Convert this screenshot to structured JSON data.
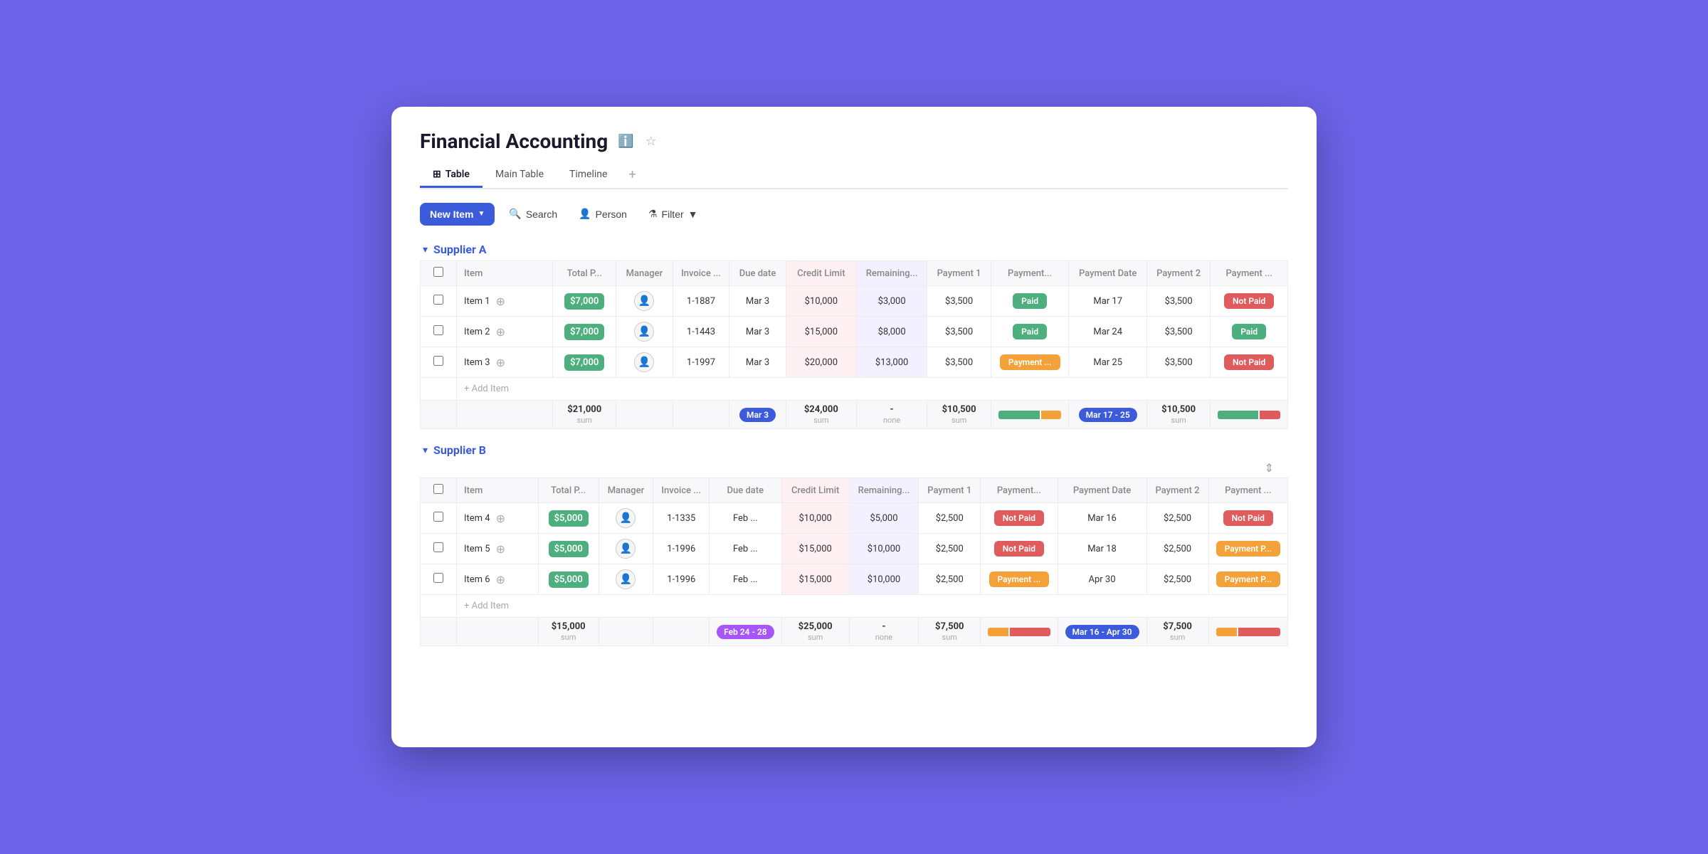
{
  "app": {
    "title": "Financial Accounting",
    "info_icon": "ℹ",
    "star_icon": "☆"
  },
  "tabs": [
    {
      "label": "Table",
      "icon": "⊞",
      "active": true
    },
    {
      "label": "Main Table",
      "active": false
    },
    {
      "label": "Timeline",
      "active": false
    }
  ],
  "toolbar": {
    "new_item_label": "New Item",
    "search_label": "Search",
    "person_label": "Person",
    "filter_label": "Filter"
  },
  "supplier_a": {
    "title": "Supplier A",
    "columns": [
      "Item",
      "Total P...",
      "Manager",
      "Invoice ...",
      "Due date",
      "Credit Limit",
      "Remaining...",
      "Payment 1",
      "Payment...",
      "Payment Date",
      "Payment 2",
      "Payment ..."
    ],
    "rows": [
      {
        "item": "Item 1",
        "total": "$7,000",
        "invoice": "1-1887",
        "due_date": "Mar 3",
        "credit_limit": "$10,000",
        "remaining": "$3,000",
        "payment1": "$3,500",
        "status1": "Paid",
        "status1_type": "paid",
        "payment_date": "Mar 17",
        "payment2": "$3,500",
        "status2": "Not Paid",
        "status2_type": "not-paid"
      },
      {
        "item": "Item 2",
        "total": "$7,000",
        "invoice": "1-1443",
        "due_date": "Mar 3",
        "credit_limit": "$15,000",
        "remaining": "$8,000",
        "payment1": "$3,500",
        "status1": "Paid",
        "status1_type": "paid",
        "payment_date": "Mar 24",
        "payment2": "$3,500",
        "status2": "Paid",
        "status2_type": "paid"
      },
      {
        "item": "Item 3",
        "total": "$7,000",
        "invoice": "1-1997",
        "due_date": "Mar 3",
        "credit_limit": "$20,000",
        "remaining": "$13,000",
        "payment1": "$3,500",
        "status1": "Payment ...",
        "status1_type": "payment-p",
        "payment_date": "Mar 25",
        "payment2": "$3,500",
        "status2": "Not Paid",
        "status2_type": "not-paid"
      }
    ],
    "add_item": "+ Add Item",
    "summary": {
      "total": "$21,000",
      "due_date": "Mar 3",
      "credit_limit": "$24,000",
      "remaining": "-",
      "remaining_sub": "none",
      "payment1": "$10,500",
      "payment2": "$10,500",
      "date_range": "Mar 17 - 25"
    }
  },
  "supplier_b": {
    "title": "Supplier B",
    "columns": [
      "Item",
      "Total P...",
      "Manager",
      "Invoice ...",
      "Due date",
      "Credit Limit",
      "Remaining...",
      "Payment 1",
      "Payment...",
      "Payment Date",
      "Payment 2",
      "Payment ..."
    ],
    "rows": [
      {
        "item": "Item 4",
        "total": "$5,000",
        "invoice": "1-1335",
        "due_date": "Feb ...",
        "credit_limit": "$10,000",
        "remaining": "$5,000",
        "payment1": "$2,500",
        "status1": "Not Paid",
        "status1_type": "not-paid",
        "payment_date": "Mar 16",
        "payment2": "$2,500",
        "status2": "Not Paid",
        "status2_type": "not-paid"
      },
      {
        "item": "Item 5",
        "total": "$5,000",
        "invoice": "1-1996",
        "due_date": "Feb ...",
        "credit_limit": "$15,000",
        "remaining": "$10,000",
        "payment1": "$2,500",
        "status1": "Not Paid",
        "status1_type": "not-paid",
        "payment_date": "Mar 18",
        "payment2": "$2,500",
        "status2": "Payment P...",
        "status2_type": "payment-p"
      },
      {
        "item": "Item 6",
        "total": "$5,000",
        "invoice": "1-1996",
        "due_date": "Feb ...",
        "credit_limit": "$15,000",
        "remaining": "$10,000",
        "payment1": "$2,500",
        "status1": "Payment ...",
        "status1_type": "payment-p",
        "payment_date": "Apr 30",
        "payment2": "$2,500",
        "status2": "Payment P...",
        "status2_type": "payment-p"
      }
    ],
    "add_item": "+ Add Item",
    "summary": {
      "total": "$15,000",
      "due_date": "Feb 24 - 28",
      "credit_limit": "$25,000",
      "remaining": "-",
      "remaining_sub": "none",
      "payment1": "$7,500",
      "payment2": "$7,500",
      "date_range": "Mar 16 - Apr 30"
    }
  }
}
